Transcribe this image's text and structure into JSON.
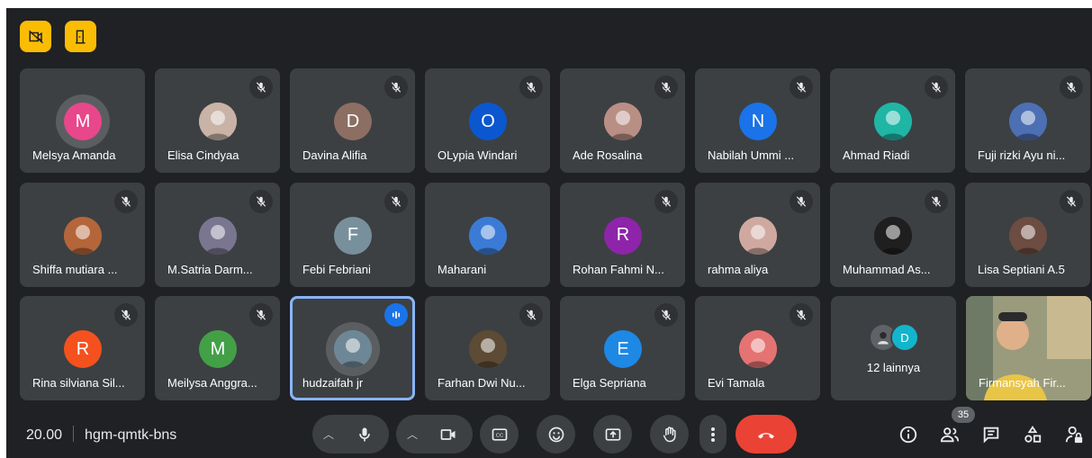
{
  "top_buttons": [
    {
      "icon": "camera-off-icon"
    },
    {
      "icon": "door-exit-icon"
    }
  ],
  "participants": [
    {
      "name": "Melsya Amanda",
      "initial": "M",
      "color": "#e8478b",
      "muted": false,
      "photo": false
    },
    {
      "name": "Elisa Cindyaa",
      "initial": "",
      "color": "#c9b3a6",
      "muted": true,
      "photo": true
    },
    {
      "name": "Davina Alifia",
      "initial": "D",
      "color": "#8d6e63",
      "muted": true,
      "photo": false
    },
    {
      "name": "OLypia Windari",
      "initial": "O",
      "color": "#0b57d0",
      "muted": true,
      "photo": false
    },
    {
      "name": "Ade Rosalina",
      "initial": "",
      "color": "#b98f85",
      "muted": true,
      "photo": true
    },
    {
      "name": "Nabilah Ummi ...",
      "initial": "N",
      "color": "#1a73e8",
      "muted": true,
      "photo": false
    },
    {
      "name": "Ahmad Riadi",
      "initial": "",
      "color": "#1fb6a6",
      "muted": true,
      "photo": true
    },
    {
      "name": "Fuji rizki Ayu ni...",
      "initial": "",
      "color": "#4d6fb3",
      "muted": true,
      "photo": true
    },
    {
      "name": "Shiffa mutiara ...",
      "initial": "",
      "color": "#b5653a",
      "muted": true,
      "photo": true
    },
    {
      "name": "M.Satria Darm...",
      "initial": "",
      "color": "#7a7690",
      "muted": true,
      "photo": true
    },
    {
      "name": "Febi Febriani",
      "initial": "F",
      "color": "#78909c",
      "muted": true,
      "photo": false
    },
    {
      "name": "Maharani",
      "initial": "",
      "color": "#3b7bd6",
      "muted": false,
      "photo": true
    },
    {
      "name": "Rohan Fahmi N...",
      "initial": "R",
      "color": "#8e24aa",
      "muted": true,
      "photo": false
    },
    {
      "name": "rahma aliya",
      "initial": "",
      "color": "#cfa9a0",
      "muted": true,
      "photo": true
    },
    {
      "name": "Muhammad As...",
      "initial": "",
      "color": "#1f1f1f",
      "muted": true,
      "photo": true
    },
    {
      "name": "Lisa Septiani A.5",
      "initial": "",
      "color": "#6d4c41",
      "muted": true,
      "photo": true
    },
    {
      "name": "Rina silviana Sil...",
      "initial": "R",
      "color": "#f4511e",
      "muted": true,
      "photo": false
    },
    {
      "name": "Meilysa Anggra...",
      "initial": "M",
      "color": "#43a047",
      "muted": true,
      "photo": false
    },
    {
      "name": "hudzaifah jr",
      "initial": "",
      "color": "#6e8796",
      "muted": false,
      "photo": true,
      "speaking": true
    },
    {
      "name": "Farhan Dwi Nu...",
      "initial": "",
      "color": "#5d4b35",
      "muted": true,
      "photo": true
    },
    {
      "name": "Elga Sepriana",
      "initial": "E",
      "color": "#1e88e5",
      "muted": true,
      "photo": false
    },
    {
      "name": "Evi Tamala",
      "initial": "",
      "color": "#e57373",
      "muted": true,
      "photo": true
    }
  ],
  "others_tile": {
    "label": "12 lainnya",
    "second_initial": "D"
  },
  "video_tile": {
    "name": "Firmansyah Fir..."
  },
  "meeting": {
    "time": "20.00",
    "code": "hgm-qmtk-bns"
  },
  "controls": {
    "mic_icon": "microphone-icon",
    "camera_icon": "video-camera-icon",
    "captions_icon": "closed-captions-icon",
    "emoji_icon": "emoji-icon",
    "present_icon": "present-screen-icon",
    "hand_icon": "raise-hand-icon",
    "more_icon": "more-options-icon",
    "hangup_icon": "hang-up-icon"
  },
  "people_count": "35",
  "colors": {
    "background": "#202124",
    "tile": "#3c4043",
    "accent_yellow": "#fbbc04",
    "hangup_red": "#ea4335",
    "speaking_blue": "#8ab4f8"
  }
}
